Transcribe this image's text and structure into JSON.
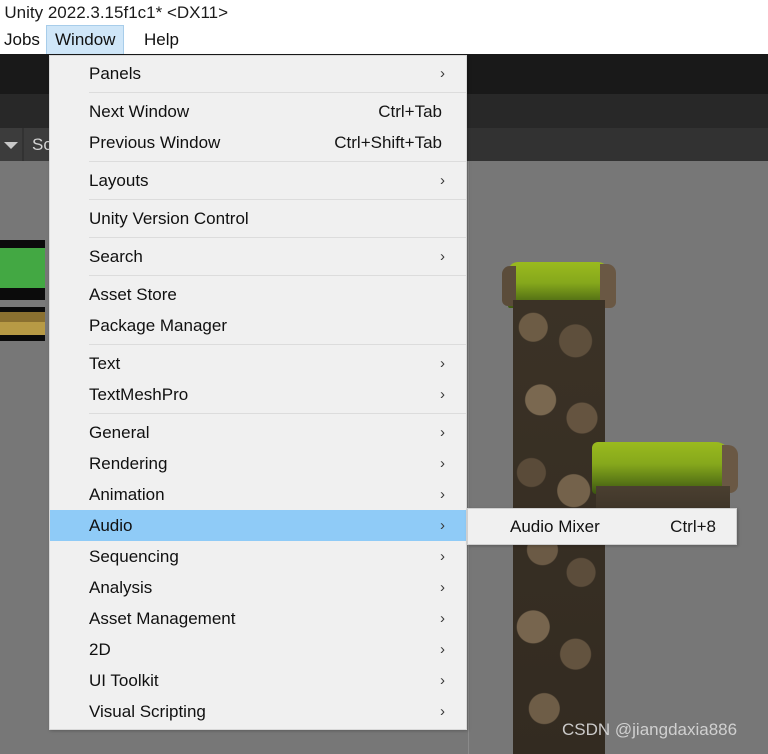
{
  "window": {
    "title": "- Unity 2022.3.15f1c1* <DX11>"
  },
  "menubar": {
    "items": [
      {
        "label": "Jobs",
        "active": false
      },
      {
        "label": "Window",
        "active": true
      },
      {
        "label": "Help",
        "active": false
      }
    ]
  },
  "editor": {
    "tab_label": "Sc",
    "caret_icon": "chevron-down-icon"
  },
  "window_menu": {
    "groups": [
      {
        "items": [
          {
            "label": "Panels",
            "shortcut": "",
            "submenu": true,
            "selected": false
          }
        ]
      },
      {
        "items": [
          {
            "label": "Next Window",
            "shortcut": "Ctrl+Tab",
            "submenu": false,
            "selected": false
          },
          {
            "label": "Previous Window",
            "shortcut": "Ctrl+Shift+Tab",
            "submenu": false,
            "selected": false
          }
        ]
      },
      {
        "items": [
          {
            "label": "Layouts",
            "shortcut": "",
            "submenu": true,
            "selected": false
          }
        ]
      },
      {
        "items": [
          {
            "label": "Unity Version Control",
            "shortcut": "",
            "submenu": false,
            "selected": false
          }
        ]
      },
      {
        "items": [
          {
            "label": "Search",
            "shortcut": "",
            "submenu": true,
            "selected": false
          }
        ]
      },
      {
        "items": [
          {
            "label": "Asset Store",
            "shortcut": "",
            "submenu": false,
            "selected": false
          },
          {
            "label": "Package Manager",
            "shortcut": "",
            "submenu": false,
            "selected": false
          }
        ]
      },
      {
        "items": [
          {
            "label": "Text",
            "shortcut": "",
            "submenu": true,
            "selected": false
          },
          {
            "label": "TextMeshPro",
            "shortcut": "",
            "submenu": true,
            "selected": false
          }
        ]
      },
      {
        "items": [
          {
            "label": "General",
            "shortcut": "",
            "submenu": true,
            "selected": false
          },
          {
            "label": "Rendering",
            "shortcut": "",
            "submenu": true,
            "selected": false
          },
          {
            "label": "Animation",
            "shortcut": "",
            "submenu": true,
            "selected": false
          },
          {
            "label": "Audio",
            "shortcut": "",
            "submenu": true,
            "selected": true
          },
          {
            "label": "Sequencing",
            "shortcut": "",
            "submenu": true,
            "selected": false
          },
          {
            "label": "Analysis",
            "shortcut": "",
            "submenu": true,
            "selected": false
          },
          {
            "label": "Asset Management",
            "shortcut": "",
            "submenu": true,
            "selected": false
          },
          {
            "label": "2D",
            "shortcut": "",
            "submenu": true,
            "selected": false
          },
          {
            "label": "UI Toolkit",
            "shortcut": "",
            "submenu": true,
            "selected": false
          },
          {
            "label": "Visual Scripting",
            "shortcut": "",
            "submenu": true,
            "selected": false
          }
        ]
      }
    ]
  },
  "audio_submenu": {
    "items": [
      {
        "label": "Audio Mixer",
        "shortcut": "Ctrl+8",
        "submenu": false,
        "selected": false
      }
    ]
  },
  "watermark": {
    "text": "CSDN @jiangdaxia886"
  },
  "colors": {
    "menu_background": "#f0f0f0",
    "menu_highlight": "#8fcbf7",
    "menubar_active": "#cfe6f8",
    "scene_background": "#777777",
    "moss_green": "#86a81c",
    "rock_brown": "#6b5a45",
    "scene_object_green": "#43a843",
    "scene_object_gold": "#b79a45"
  },
  "icons": {
    "submenu_arrow": "chevron-right-icon"
  }
}
